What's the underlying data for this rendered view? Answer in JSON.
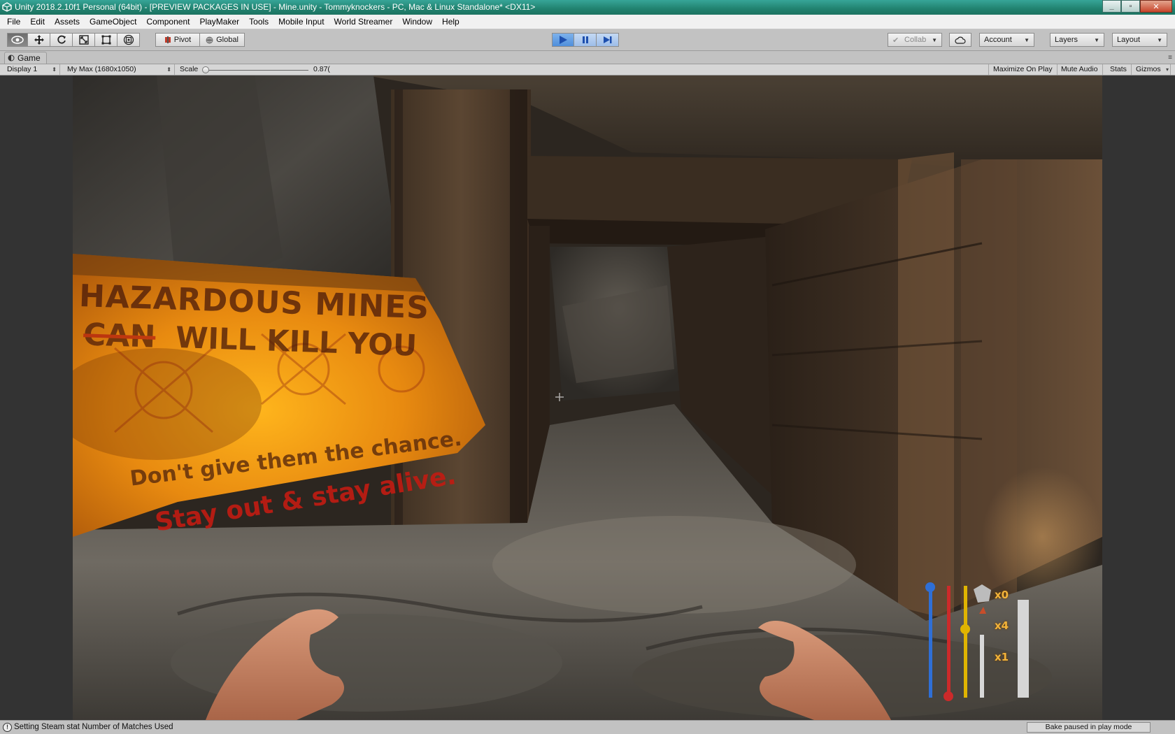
{
  "window": {
    "title": "Unity 2018.2.10f1 Personal (64bit) - [PREVIEW PACKAGES IN USE] - Mine.unity - Tommyknockers - PC, Mac & Linux Standalone* <DX11>",
    "minimize_label": "_",
    "maximize_label": "▫",
    "close_label": "✕"
  },
  "menu": [
    "File",
    "Edit",
    "Assets",
    "GameObject",
    "Component",
    "PlayMaker",
    "Tools",
    "Mobile Input",
    "World Streamer",
    "Window",
    "Help"
  ],
  "toolbar": {
    "tools": [
      "view-tool",
      "move-tool",
      "rotate-tool",
      "scale-tool",
      "rect-tool",
      "transform-tool"
    ],
    "pivot_label": "Pivot",
    "global_label": "Global",
    "collab_label": "Collab",
    "account_label": "Account",
    "layers_label": "Layers",
    "layout_label": "Layout",
    "play_state": "playing"
  },
  "game_tab": {
    "label": "Game"
  },
  "game_toolbar": {
    "display": "Display 1",
    "resolution": "My Max (1680x1050)",
    "scale_label": "Scale",
    "scale_value": "0.87(",
    "maximize_on_play": "Maximize On Play",
    "mute_audio": "Mute Audio",
    "stats": "Stats",
    "gizmos": "Gizmos"
  },
  "scene": {
    "sign_line1": "HAZARDOUS MINES",
    "sign_struck": "CAN",
    "sign_line2": "WILL KILL YOU",
    "sign_line3": "Don't give them the chance.",
    "sign_line4": "Stay out & stay alive."
  },
  "hud": {
    "label_top": "x0",
    "label_mid": "x4",
    "label_bottom": "x1",
    "colors": {
      "blue": "#2f6fd6",
      "red": "#cc2a2a",
      "yellow": "#e0b400",
      "white": "#e8e8e8"
    }
  },
  "status": {
    "message": "Setting Steam stat Number of Matches Used",
    "bake": "Bake paused in play mode"
  }
}
